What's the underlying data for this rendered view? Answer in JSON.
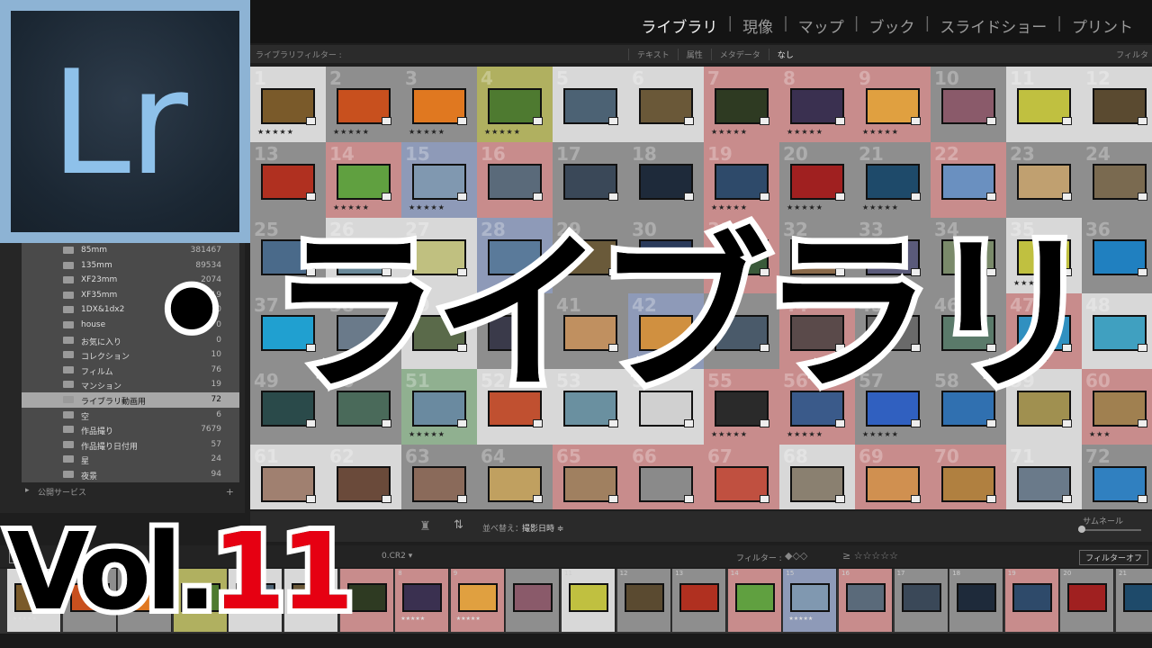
{
  "modules": [
    "ライブラリ",
    "現像",
    "マップ",
    "ブック",
    "スライドショー",
    "プリント"
  ],
  "filter_bar": {
    "label": "ライブラリフィルター :",
    "options": [
      "テキスト",
      "属性",
      "メタデータ",
      "なし"
    ],
    "right_label": "フィルタ"
  },
  "grid": {
    "rows": [
      [
        {
          "n": "1",
          "bg": "#d8d8d8",
          "img": "#7a5a2a",
          "stars": "★★★★★"
        },
        {
          "n": "2",
          "bg": "#8e8e8e",
          "img": "#c8501e",
          "stars": "★★★★★"
        },
        {
          "n": "3",
          "bg": "#8e8e8e",
          "img": "#e07820",
          "stars": "★★★★★"
        },
        {
          "n": "4",
          "bg": "#b0b060",
          "img": "#4e7a30",
          "stars": "★★★★★"
        },
        {
          "n": "5",
          "bg": "#d8d8d8",
          "img": "#4c6274"
        },
        {
          "n": "6",
          "bg": "#d8d8d8",
          "img": "#6a5838"
        },
        {
          "n": "7",
          "bg": "#c88c8c",
          "img": "#2e3a22",
          "stars": "★★★★★"
        },
        {
          "n": "8",
          "bg": "#c88c8c",
          "img": "#3a3050",
          "stars": "★★★★★"
        },
        {
          "n": "9",
          "bg": "#c88c8c",
          "img": "#e0a040",
          "stars": "★★★★★"
        },
        {
          "n": "10",
          "bg": "#8e8e8e",
          "img": "#8a5a6a"
        },
        {
          "n": "11",
          "bg": "#d8d8d8",
          "img": "#c0c040"
        },
        {
          "n": "12",
          "bg": "#d8d8d8",
          "img": "#5a4a30"
        }
      ],
      [
        {
          "n": "13",
          "bg": "#8e8e8e",
          "img": "#b03020"
        },
        {
          "n": "14",
          "bg": "#c88c8c",
          "img": "#60a040",
          "stars": "★★★★★"
        },
        {
          "n": "15",
          "bg": "#8e9ab8",
          "img": "#8098b0",
          "stars": "★★★★★"
        },
        {
          "n": "16",
          "bg": "#c88c8c",
          "img": "#5a6a7a"
        },
        {
          "n": "17",
          "bg": "#8e8e8e",
          "img": "#3a4858"
        },
        {
          "n": "18",
          "bg": "#8e8e8e",
          "img": "#1e2a3a"
        },
        {
          "n": "19",
          "bg": "#c88c8c",
          "img": "#2e4a6a",
          "stars": "★★★★★"
        },
        {
          "n": "20",
          "bg": "#8e8e8e",
          "img": "#a02020",
          "stars": "★★★★★"
        },
        {
          "n": "21",
          "bg": "#8e8e8e",
          "img": "#1e4a6a",
          "stars": "★★★★★"
        },
        {
          "n": "22",
          "bg": "#c88c8c",
          "img": "#6a90c0"
        },
        {
          "n": "23",
          "bg": "#8e8e8e",
          "img": "#c0a070"
        },
        {
          "n": "24",
          "bg": "#8e8e8e",
          "img": "#7a6a50"
        }
      ],
      [
        {
          "n": "25",
          "bg": "#8e8e8e",
          "img": "#4a6a8a"
        },
        {
          "n": "26",
          "bg": "#d8d8d8",
          "img": "#6a8a9a"
        },
        {
          "n": "27",
          "bg": "#d8d8d8",
          "img": "#c0c080"
        },
        {
          "n": "28",
          "bg": "#8e9ab8",
          "img": "#5a7a9a"
        },
        {
          "n": "29",
          "bg": "#8e8e8e",
          "img": "#6a5a3a"
        },
        {
          "n": "30",
          "bg": "#8e8e8e",
          "img": "#2a3a5a"
        },
        {
          "n": "31",
          "bg": "#c88c8c",
          "img": "#3a5a3a"
        },
        {
          "n": "32",
          "bg": "#8e8e8e",
          "img": "#8a6a4a"
        },
        {
          "n": "33",
          "bg": "#8e8e8e",
          "img": "#5a5a7a"
        },
        {
          "n": "34",
          "bg": "#8e8e8e",
          "img": "#7a8a6a"
        },
        {
          "n": "35",
          "bg": "#d8d8d8",
          "img": "#c0c040",
          "stars": "★★★★★"
        },
        {
          "n": "36",
          "bg": "#8e8e8e",
          "img": "#2080c0"
        }
      ],
      [
        {
          "n": "37",
          "bg": "#8e8e8e",
          "img": "#20a0d0"
        },
        {
          "n": "38",
          "bg": "#8e8e8e",
          "img": "#6a7a8a"
        },
        {
          "n": "39",
          "bg": "#d8d8d8",
          "img": "#5a6a4a"
        },
        {
          "n": "40",
          "bg": "#8e8e8e",
          "img": "#3a3a4a"
        },
        {
          "n": "41",
          "bg": "#8e8e8e",
          "img": "#c09060"
        },
        {
          "n": "42",
          "bg": "#8e9ab8",
          "img": "#d09040"
        },
        {
          "n": "43",
          "bg": "#8e8e8e",
          "img": "#4a5a6a"
        },
        {
          "n": "44",
          "bg": "#c88c8c",
          "img": "#5a4a4a"
        },
        {
          "n": "45",
          "bg": "#8e8e8e",
          "img": "#6a6a6a"
        },
        {
          "n": "46",
          "bg": "#8e8e8e",
          "img": "#5a7a6a"
        },
        {
          "n": "47",
          "bg": "#c88c8c",
          "img": "#3090c0",
          "stars": "★★★★★"
        },
        {
          "n": "48",
          "bg": "#d8d8d8",
          "img": "#40a0c0"
        }
      ],
      [
        {
          "n": "49",
          "bg": "#8e8e8e",
          "img": "#2a4a4a"
        },
        {
          "n": "50",
          "bg": "#8e8e8e",
          "img": "#4a6a5a"
        },
        {
          "n": "51",
          "bg": "#90b090",
          "img": "#6a8aa0",
          "stars": "★★★★★"
        },
        {
          "n": "52",
          "bg": "#d8d8d8",
          "img": "#c05030"
        },
        {
          "n": "53",
          "bg": "#d8d8d8",
          "img": "#6a90a0"
        },
        {
          "n": "54",
          "bg": "#d8d8d8",
          "img": "#d0d0d0"
        },
        {
          "n": "55",
          "bg": "#c88c8c",
          "img": "#2a2a2a",
          "stars": "★★★★★"
        },
        {
          "n": "56",
          "bg": "#c88c8c",
          "img": "#3a5a8a",
          "stars": "★★★★★"
        },
        {
          "n": "57",
          "bg": "#8e8e8e",
          "img": "#3060c0",
          "stars": "★★★★★"
        },
        {
          "n": "58",
          "bg": "#8e8e8e",
          "img": "#3070b0"
        },
        {
          "n": "59",
          "bg": "#d8d8d8",
          "img": "#a09050"
        },
        {
          "n": "60",
          "bg": "#c88c8c",
          "img": "#a08050",
          "stars": "★★★"
        }
      ],
      [
        {
          "n": "61",
          "bg": "#d8d8d8",
          "img": "#a08070"
        },
        {
          "n": "62",
          "bg": "#d8d8d8",
          "img": "#6a4a3a"
        },
        {
          "n": "63",
          "bg": "#8e8e8e",
          "img": "#8a6a5a"
        },
        {
          "n": "64",
          "bg": "#8e8e8e",
          "img": "#c0a060"
        },
        {
          "n": "65",
          "bg": "#c88c8c",
          "img": "#a08060"
        },
        {
          "n": "66",
          "bg": "#c88c8c",
          "img": "#8a8a8a"
        },
        {
          "n": "67",
          "bg": "#c88c8c",
          "img": "#c05040"
        },
        {
          "n": "68",
          "bg": "#d8d8d8",
          "img": "#8a8070"
        },
        {
          "n": "69",
          "bg": "#c88c8c",
          "img": "#d09050"
        },
        {
          "n": "70",
          "bg": "#c88c8c",
          "img": "#b08040"
        },
        {
          "n": "71",
          "bg": "#d8d8d8",
          "img": "#6a7a8a"
        },
        {
          "n": "72",
          "bg": "#8e8e8e",
          "img": "#3080c0"
        }
      ]
    ]
  },
  "folders": [
    {
      "name": "85mm",
      "count": "381467"
    },
    {
      "name": "135mm",
      "count": "89534"
    },
    {
      "name": "XF23mm",
      "count": "2074"
    },
    {
      "name": "XF35mm",
      "count": "24819"
    },
    {
      "name": "1DX&1dx2",
      "count": "0"
    },
    {
      "name": "house",
      "count": "0"
    },
    {
      "name": "お気に入り",
      "count": "0"
    },
    {
      "name": "コレクション",
      "count": "10"
    },
    {
      "name": "フィルム",
      "count": "76"
    },
    {
      "name": "マンション",
      "count": "19"
    },
    {
      "name": "ライブラリ動画用",
      "count": "72",
      "selected": true
    },
    {
      "name": "空",
      "count": "6"
    },
    {
      "name": "作品撮り",
      "count": "7679"
    },
    {
      "name": "作品撮り日付用",
      "count": "57"
    },
    {
      "name": "星",
      "count": "24"
    },
    {
      "name": "夜景",
      "count": "94"
    }
  ],
  "publish_services": "公開サービス",
  "toolbar": {
    "sort_label": "並べ替え：",
    "sort_value": "撮影日時 ≑",
    "thumb_label": "サムネール"
  },
  "filmstrip_header": {
    "page": "1",
    "file_name": "0.CR2 ▾",
    "filter_label": "フィルター :",
    "filter_button": "フィルターオフ"
  },
  "filmstrip": [
    {
      "n": "",
      "img": "#7a5a2a",
      "bg": "#d8d8d8",
      "stars": "★★★★★"
    },
    {
      "n": "",
      "img": "#c8501e",
      "bg": "#8e8e8e"
    },
    {
      "n": "",
      "img": "#e07820",
      "bg": "#8e8e8e"
    },
    {
      "n": "",
      "img": "#4e7a30",
      "bg": "#b0b060"
    },
    {
      "n": "",
      "img": "#4c6274",
      "bg": "#d8d8d8"
    },
    {
      "n": "",
      "img": "#6a5838",
      "bg": "#d8d8d8"
    },
    {
      "n": "",
      "img": "#2e3a22",
      "bg": "#c88c8c"
    },
    {
      "n": "8",
      "img": "#3a3050",
      "bg": "#c88c8c",
      "stars": "★★★★★"
    },
    {
      "n": "9",
      "img": "#e0a040",
      "bg": "#c88c8c",
      "stars": "★★★★★"
    },
    {
      "n": "",
      "img": "#8a5a6a",
      "bg": "#8e8e8e"
    },
    {
      "n": "11",
      "img": "#c0c040",
      "bg": "#d8d8d8"
    },
    {
      "n": "12",
      "img": "#5a4a30",
      "bg": "#8e8e8e"
    },
    {
      "n": "13",
      "img": "#b03020",
      "bg": "#8e8e8e"
    },
    {
      "n": "14",
      "img": "#60a040",
      "bg": "#c88c8c"
    },
    {
      "n": "15",
      "img": "#8098b0",
      "bg": "#8e9ab8",
      "stars": "★★★★★"
    },
    {
      "n": "16",
      "img": "#5a6a7a",
      "bg": "#c88c8c"
    },
    {
      "n": "17",
      "img": "#3a4858",
      "bg": "#8e8e8e"
    },
    {
      "n": "18",
      "img": "#1e2a3a",
      "bg": "#8e8e8e"
    },
    {
      "n": "19",
      "img": "#2e4a6a",
      "bg": "#c88c8c"
    },
    {
      "n": "20",
      "img": "#a02020",
      "bg": "#8e8e8e"
    },
    {
      "n": "21",
      "img": "#1e4a6a",
      "bg": "#8e8e8e"
    }
  ],
  "logo_text": "Lr",
  "title": "・ライブラリ",
  "vol": {
    "prefix": "Vol.",
    "number": "11"
  }
}
